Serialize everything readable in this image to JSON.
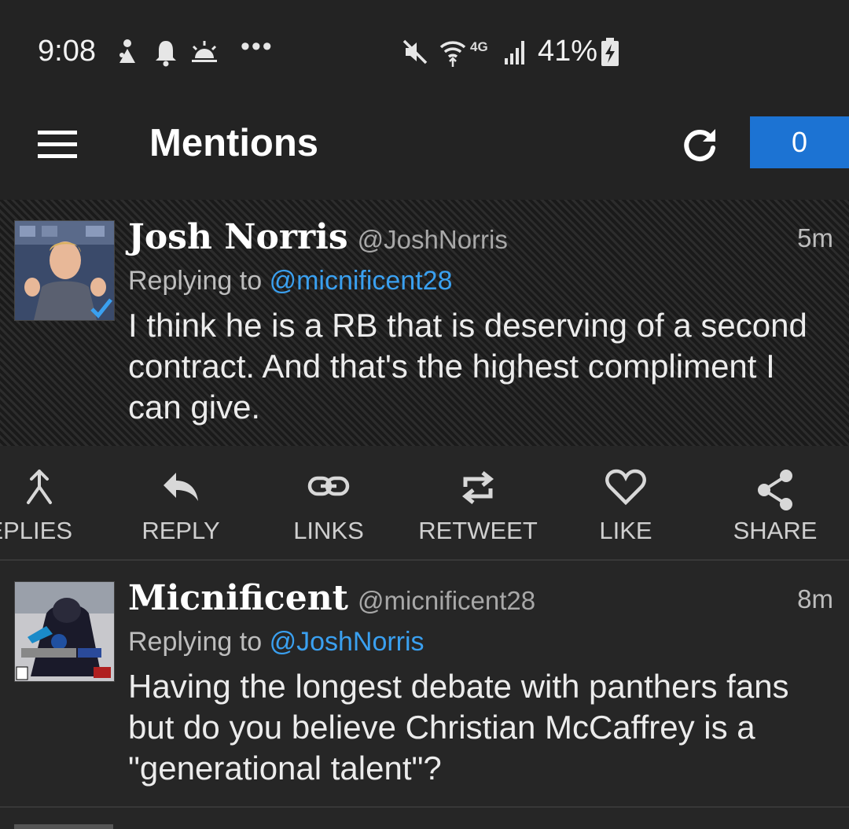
{
  "status_bar": {
    "time": "9:08",
    "network": "4G",
    "battery": "41%",
    "icons": [
      "usb-debug-icon",
      "notification-bell-icon",
      "weather-icon",
      "mute-icon",
      "wifi-icon",
      "signal-icon",
      "battery-charging-icon"
    ],
    "more": "•••"
  },
  "app_bar": {
    "title": "Mentions",
    "count": "0",
    "accent": "#1c73d3"
  },
  "tweets": [
    {
      "name": "Josh Norris",
      "handle": "@JoshNorris",
      "time": "5m",
      "replying_prefix": "Replying to",
      "replying_to": "@micnificent28",
      "text": "I think he is a RB that is deserving of a second contract. And that's the highest compliment I can give.",
      "verified": true
    },
    {
      "name": "Micnificent",
      "handle": "@micnificent28",
      "time": "8m",
      "replying_prefix": "Replying to",
      "replying_to": "@JoshNorris",
      "text": "Having the longest debate with panthers fans but do you believe Christian McCaffrey is a \"generational talent\"?"
    }
  ],
  "actions": [
    {
      "label": "EPLIES",
      "icon": "replies-branch-icon"
    },
    {
      "label": "REPLY",
      "icon": "reply-arrow-icon"
    },
    {
      "label": "LINKS",
      "icon": "link-icon"
    },
    {
      "label": "RETWEET",
      "icon": "retweet-icon"
    },
    {
      "label": "LIKE",
      "icon": "heart-icon"
    },
    {
      "label": "SHARE",
      "icon": "share-icon"
    }
  ],
  "colors": {
    "background": "#262626",
    "link": "#3aa0f0",
    "verified": "#3aa0f0"
  }
}
